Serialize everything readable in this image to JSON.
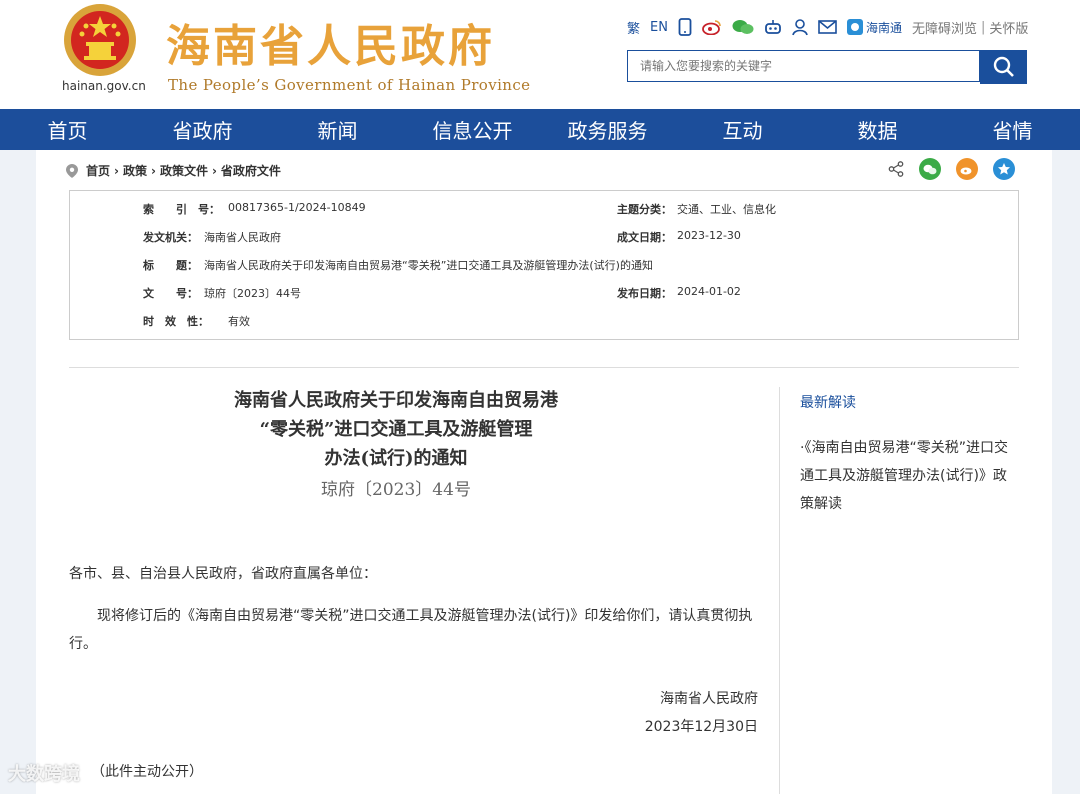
{
  "header": {
    "site_url": "hainan.gov.cn",
    "site_title": "海南省人民政府",
    "site_subtitle": "The People’s Government  of Hainan Province",
    "toolbar": {
      "traditional": "繁",
      "english": "EN",
      "hainan_tong": "海南通",
      "accessibility": "无障碍浏览",
      "separator": "|",
      "elder_care": "关怀版"
    },
    "search_placeholder": "请输入您要搜索的关键字"
  },
  "nav": [
    "首页",
    "省政府",
    "新闻",
    "信息公开",
    "政务服务",
    "互动",
    "数据",
    "省情"
  ],
  "breadcrumb": [
    "首页",
    "政策",
    "政策文件",
    "省政府文件"
  ],
  "meta": {
    "index_label": "索　　引　号：",
    "index_value": "00817365-1/2024-10849",
    "topic_label": "主题分类：",
    "topic_value": "交通、工业、信息化",
    "issuer_label": "发文机关：",
    "issuer_value": "海南省人民政府",
    "created_label": "成文日期：",
    "created_value": "2023-12-30",
    "title_label": "标　　题：",
    "title_value": "海南省人民政府关于印发海南自由贸易港“零关税”进口交通工具及游艇管理办法(试行)的通知",
    "docno_label": "文　　号：",
    "docno_value": "琼府〔2023〕44号",
    "published_label": "发布日期：",
    "published_value": "2024-01-02",
    "validity_label": "时　效　性：",
    "validity_value": "有效"
  },
  "document": {
    "title_lines": [
      "海南省人民政府关于印发海南自由贸易港",
      "“零关税”进口交通工具及游艇管理",
      "办法(试行)的通知"
    ],
    "number": "琼府〔2023〕44号",
    "salutation": "各市、县、自治县人民政府，省政府直属各单位：",
    "paragraph": "现将修订后的《海南自由贸易港“零关税”进口交通工具及游艇管理办法(试行)》印发给你们，请认真贯彻执行。",
    "signature_org": "海南省人民政府",
    "signature_date": "2023年12月30日",
    "disclosure": "（此件主动公开）"
  },
  "sidebar": {
    "title": "最新解读",
    "link": "·《海南自由贸易港“零关税”进口交通工具及游艇管理办法(试行)》政策解读"
  },
  "watermark": "大数跨境",
  "colors": {
    "nav_bg": "#1c4e9b",
    "accent": "#1a4f9c",
    "title_gold": "#e8a23a"
  }
}
